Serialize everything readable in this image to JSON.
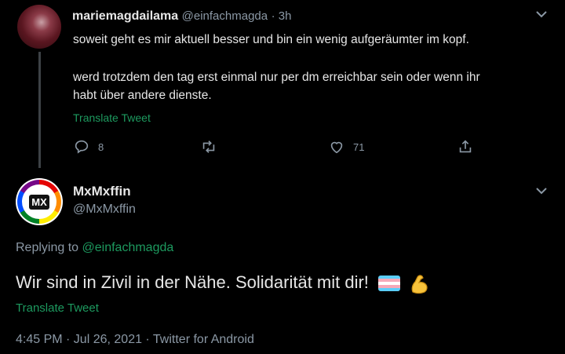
{
  "reply_tweet": {
    "display_name": "mariemagdailama",
    "handle": "@einfachmagda",
    "time": "· 3h",
    "line1": "soweit geht es mir aktuell besser und bin ein wenig aufgeräumter im kopf.",
    "line2": "werd trotzdem den tag erst einmal nur per dm erreichbar sein oder wenn ihr",
    "line3": "habt über andere dienste.",
    "translate": "Translate Tweet",
    "reply_count": "8",
    "like_count": "71"
  },
  "main_tweet": {
    "display_name": "MxMxffin",
    "handle": "@MxMxffin",
    "avatar_text": "MX",
    "replying_to_label": "Replying to",
    "replying_to_handle": "@einfachmagda",
    "text": "Wir sind in Zivil in der Nähe. Solidarität mit dir!",
    "translate": "Translate Tweet",
    "meta": "4:45 PM · Jul 26, 2021 · Twitter for Android"
  },
  "icons": [
    "chevron-down-icon",
    "reply-icon",
    "retweet-icon",
    "like-icon",
    "share-icon",
    "trans-flag-emoji",
    "flexed-biceps-emoji"
  ],
  "colors": {
    "background": "#000000",
    "accent": "#1d9a5f",
    "muted": "#8b98a5"
  }
}
